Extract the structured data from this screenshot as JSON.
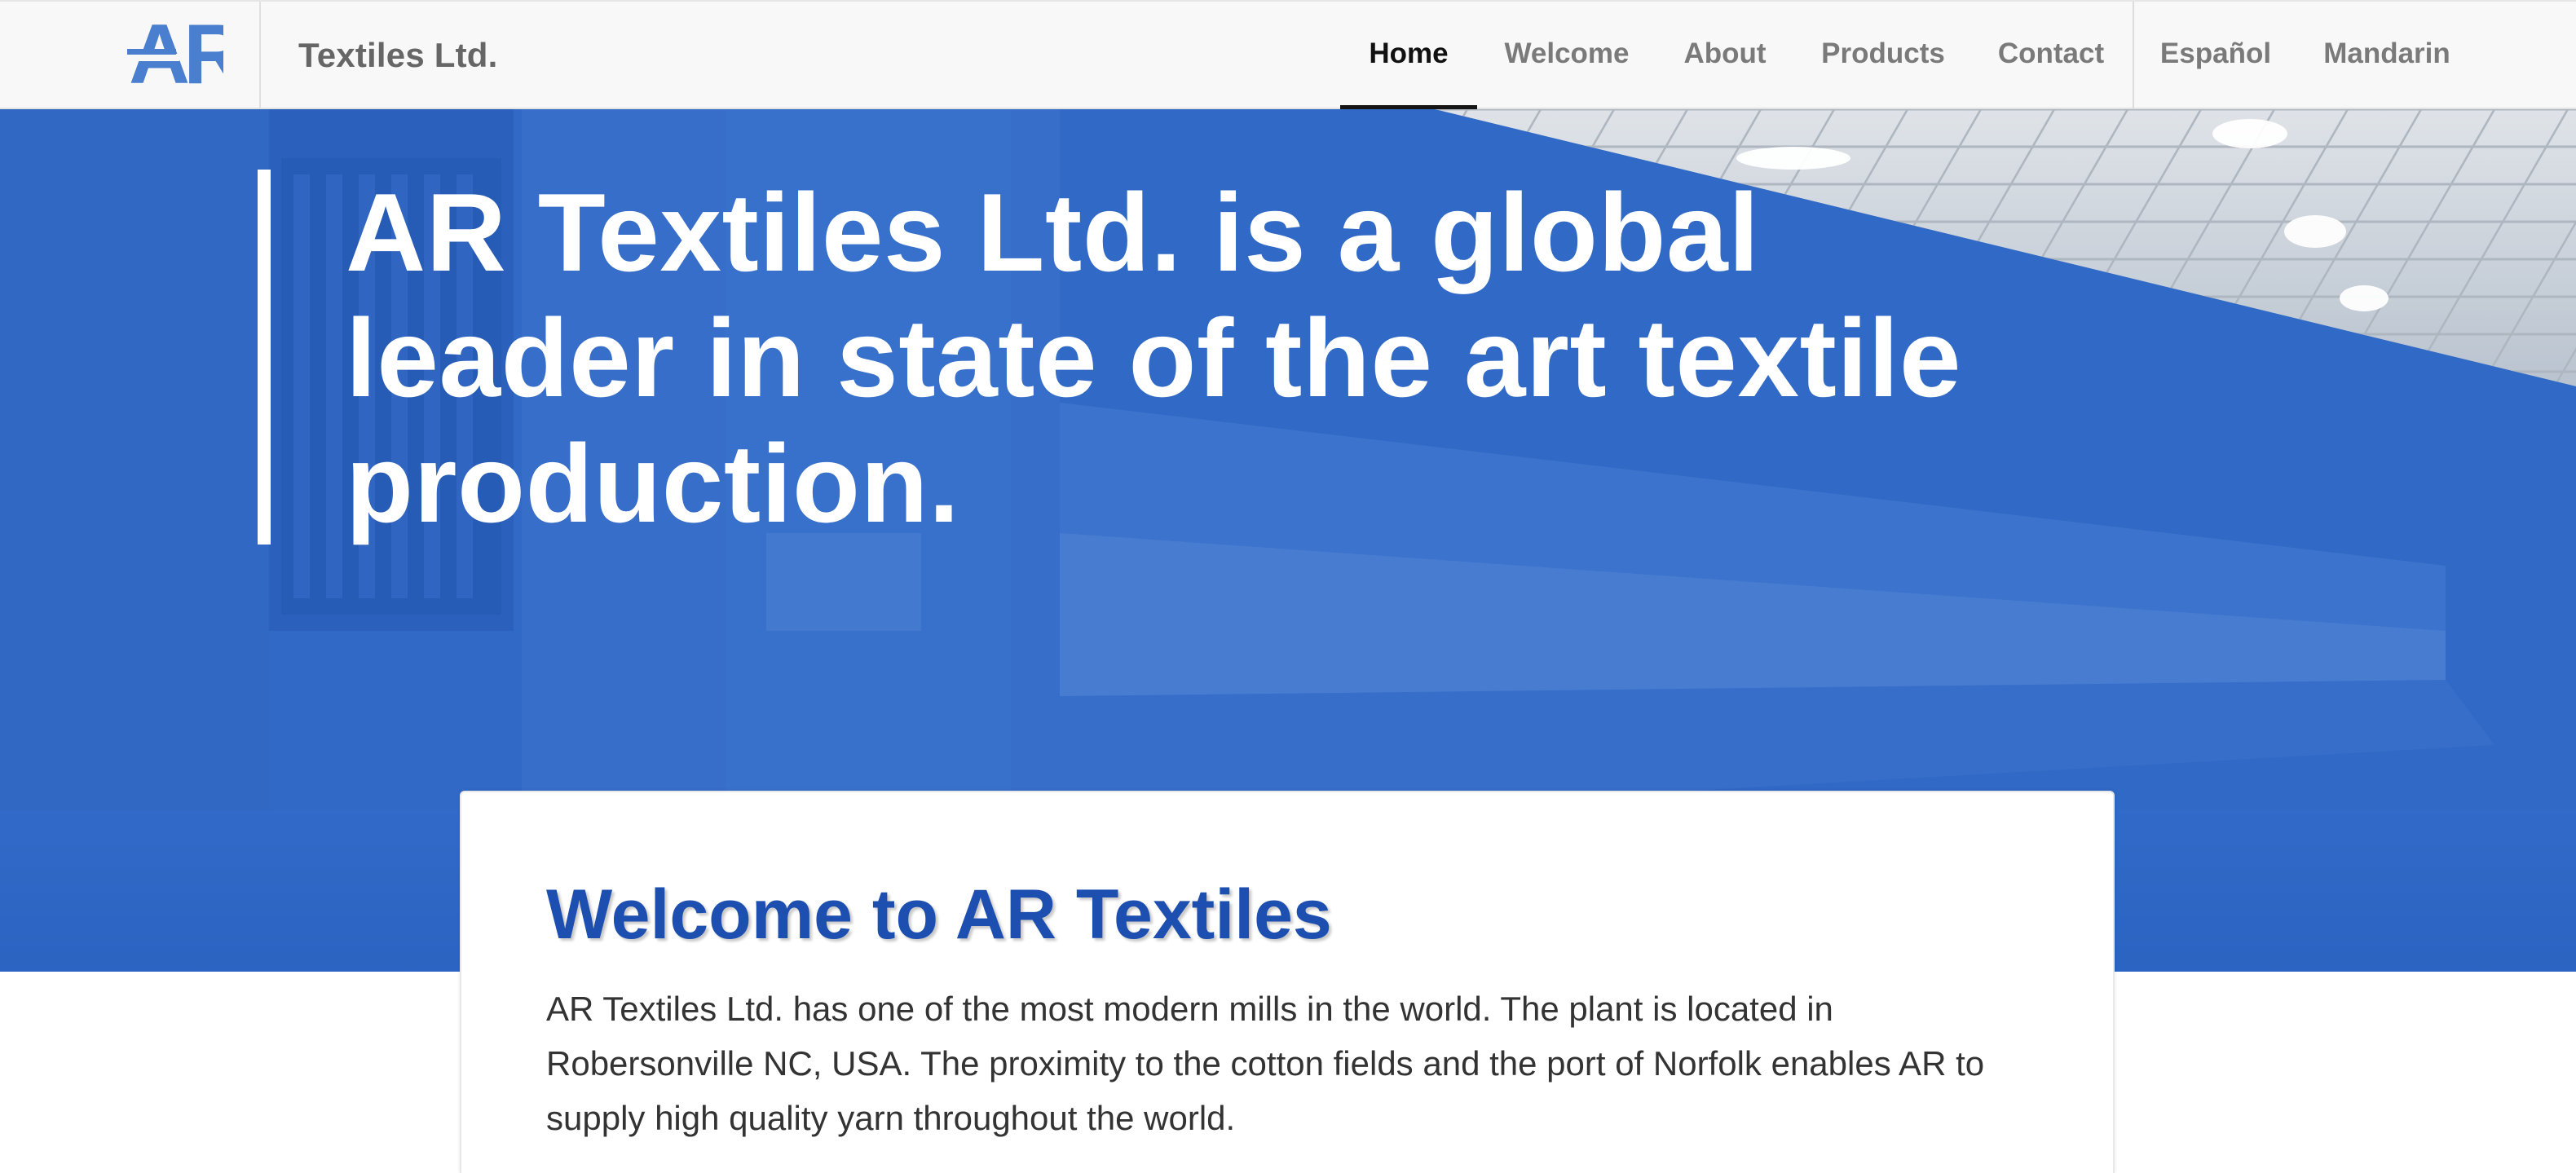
{
  "navbar": {
    "logo_text": "AR",
    "brand": "Textiles Ltd.",
    "items": [
      {
        "label": "Home",
        "active": true
      },
      {
        "label": "Welcome",
        "active": false
      },
      {
        "label": "About",
        "active": false
      },
      {
        "label": "Products",
        "active": false
      },
      {
        "label": "Contact",
        "active": false
      },
      {
        "label": "Español",
        "active": false
      },
      {
        "label": "Mandarin",
        "active": false
      }
    ]
  },
  "hero": {
    "headline": "AR Textiles Ltd. is a global leader in state of the art textile production."
  },
  "welcome": {
    "title": "Welcome to AR Textiles",
    "body": "AR Textiles Ltd. has one of the most modern mills in the world. The plant is located in Robersonville NC, USA. The proximity to the cotton fields and the port of Norfolk enables AR to supply high quality yarn throughout the world."
  },
  "colors": {
    "brand_blue": "#1d4fb0",
    "hero_blue": "#2a62c4",
    "logo_blue": "#4a7fcf",
    "nav_bg": "#f8f8f8"
  }
}
